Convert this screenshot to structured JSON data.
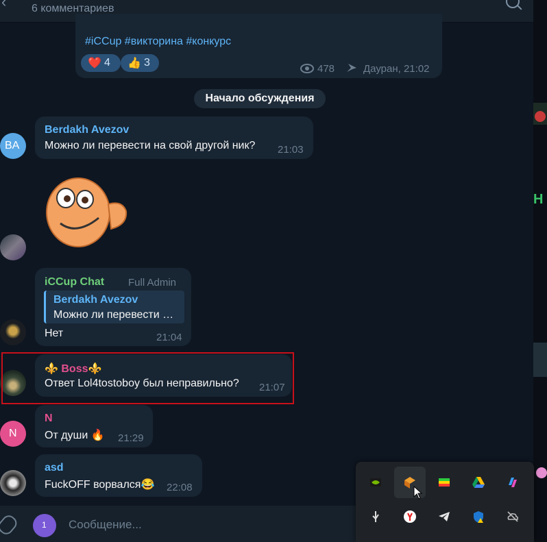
{
  "header": {
    "title": "6 комментариев"
  },
  "post": {
    "hashtags": "#iCCup #викторина #конкурс",
    "reactions": [
      {
        "emoji": "❤️",
        "count": "4"
      },
      {
        "emoji": "👍",
        "count": "3"
      }
    ],
    "views": "478",
    "author_time": "Дауран, 21:02"
  },
  "divider": "Начало обсуждения",
  "messages": [
    {
      "avatar_initials": "BA",
      "name": "Berdakh Avezov",
      "text": "Можно ли перевести на свой другой ник?",
      "time": "21:03"
    },
    {
      "name": "iCCup Chat",
      "role": "Full Admin",
      "reply_name": "Berdakh Avezov",
      "reply_text": "Можно ли перевести …",
      "text": "Нет",
      "time": "21:04"
    },
    {
      "name": "⚜️ Boss⚜️",
      "text": "Ответ Lol4tostoboy был неправильно?",
      "time": "21:07"
    },
    {
      "avatar_initials": "N",
      "name": "N",
      "text": "От души 🔥",
      "time": "21:29"
    },
    {
      "name": "asd",
      "text": "FuckOFF ворвался😂",
      "time": "22:08"
    }
  ],
  "composer": {
    "placeholder": "Сообщение...",
    "badge": "1"
  },
  "tray_icons": [
    "nvidia-icon",
    "app-icon",
    "bluestacks-icon",
    "google-drive-icon",
    "copilot-icon",
    "usb-icon",
    "yandex-icon",
    "telegram-icon",
    "defender-icon",
    "onedrive-off-icon"
  ],
  "colors": {
    "bg": "#0e1621",
    "bubble": "#182533",
    "accent_blue": "#5eb5f7",
    "admin_green": "#6fd07a",
    "boss_pink": "#e3508d",
    "n_pink": "#e3508d",
    "highlight_red": "#c8101a"
  }
}
